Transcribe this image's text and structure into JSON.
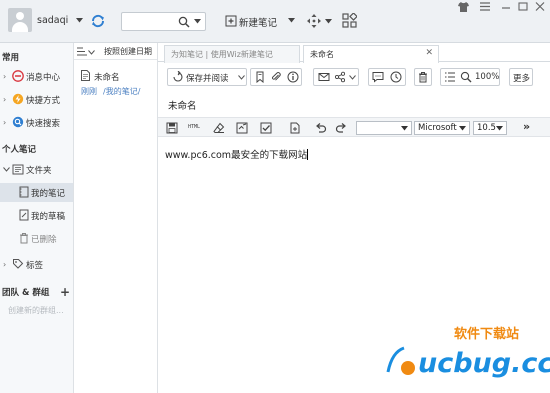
{
  "topbar": {
    "username": "sadaqi",
    "search_placeholder": "",
    "new_note_label": "新建笔记",
    "icons": [
      "user-avatar",
      "sync-icon",
      "search-icon",
      "new-note-icon",
      "move-icon",
      "grid-icon",
      "shirt-icon",
      "menu-icon",
      "minimize-icon",
      "maximize-icon",
      "close-icon"
    ]
  },
  "sidebar": {
    "section_common": "常用",
    "items": [
      {
        "label": "消息中心",
        "icon": "message-icon"
      },
      {
        "label": "快捷方式",
        "icon": "shortcut-icon"
      },
      {
        "label": "快速搜索",
        "icon": "quick-search-icon"
      }
    ],
    "section_personal": "个人笔记",
    "folder_label": "文件夹",
    "sub_items": [
      {
        "label": "我的笔记",
        "selected": true
      },
      {
        "label": "我的草稿",
        "selected": false
      },
      {
        "label": "已删除",
        "selected": false
      }
    ],
    "tags_label": "标签",
    "section_team": "团队 & 群组",
    "team_placeholder": "创建新的群组..."
  },
  "note_list": {
    "sort_label": "按照创建日期",
    "item": {
      "title": "未命名",
      "time": "刚刚",
      "path": "/我的笔记/"
    }
  },
  "tabs": [
    {
      "label": "为知笔记 | 使用Wiz新建笔记",
      "active": false
    },
    {
      "label": "未命名",
      "active": true
    }
  ],
  "toolbar": {
    "save_read_label": "保存并阅读",
    "zoom_label": "100%",
    "more_label": "更多"
  },
  "note": {
    "title": "未命名",
    "content": "www.pc6.com最安全的下载网站"
  },
  "format_bar": {
    "style_value": "",
    "font_value": "Microsoft",
    "size_value": "10.5",
    "more_symbol": "»"
  },
  "watermark": {
    "brand": "ucbug.cc",
    "slogan": "软件下载站"
  },
  "colors": {
    "accent_blue": "#2f7fd1",
    "link_blue": "#4a7fc1",
    "watermark_orange": "#f08a12",
    "watermark_blue": "#1a8ee0"
  }
}
